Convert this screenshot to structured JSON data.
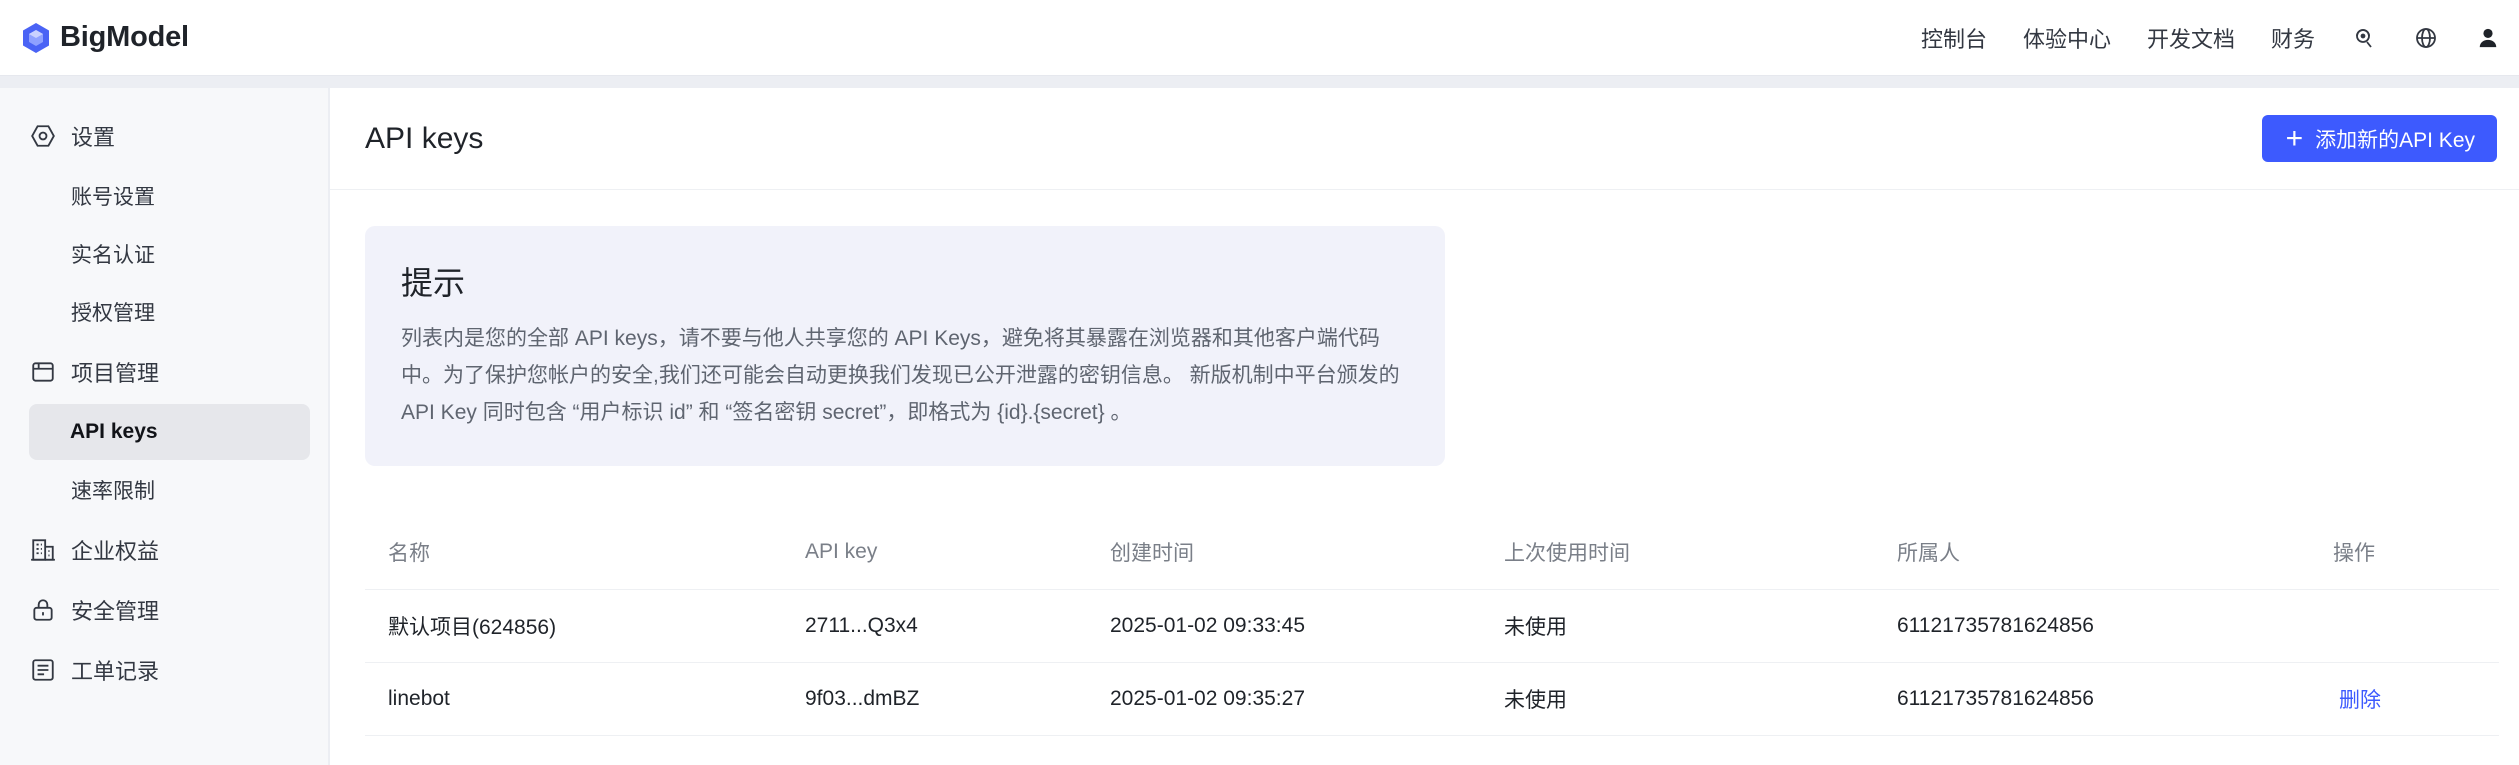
{
  "brand": {
    "name": "BigModel"
  },
  "topnav": {
    "links": [
      "控制台",
      "体验中心",
      "开发文档",
      "财务"
    ],
    "icons": [
      "support-icon",
      "globe-icon",
      "user-icon"
    ]
  },
  "sidebar": {
    "groups": [
      {
        "label": "设置",
        "icon": "settings-icon",
        "items": [
          "账号设置",
          "实名认证",
          "授权管理"
        ]
      },
      {
        "label": "项目管理",
        "icon": "project-icon",
        "items": [
          "API keys",
          "速率限制"
        ],
        "active": "API keys"
      },
      {
        "label": "企业权益",
        "icon": "enterprise-icon",
        "items": []
      },
      {
        "label": "安全管理",
        "icon": "lock-icon",
        "items": []
      },
      {
        "label": "工单记录",
        "icon": "ticket-icon",
        "items": []
      }
    ]
  },
  "main": {
    "title": "API keys",
    "add_button": "添加新的API Key",
    "tip": {
      "title": "提示",
      "body": "列表内是您的全部 API keys，请不要与他人共享您的 API Keys，避免将其暴露在浏览器和其他客户端代码中。为了保护您帐户的安全,我们还可能会自动更换我们发现已公开泄露的密钥信息。 新版机制中平台颁发的 API Key 同时包含 “用户标识 id” 和 “签名密钥 secret”，即格式为 {id}.{secret} 。"
    },
    "table": {
      "columns": [
        "名称",
        "API key",
        "创建时间",
        "上次使用时间",
        "所属人",
        "操作"
      ],
      "rows": [
        {
          "name": "默认项目(624856)",
          "key": "2711...Q3x4",
          "created": "2025-01-02 09:33:45",
          "last_used": "未使用",
          "owner": "61121735781624856",
          "action": ""
        },
        {
          "name": "linebot",
          "key": "9f03...dmBZ",
          "created": "2025-01-02 09:35:27",
          "last_used": "未使用",
          "owner": "61121735781624856",
          "action": "删除"
        }
      ]
    }
  },
  "colors": {
    "accent": "#3d5afe",
    "tip_bg": "#f1f2fa",
    "sidebar_bg": "#f7f8fa"
  }
}
